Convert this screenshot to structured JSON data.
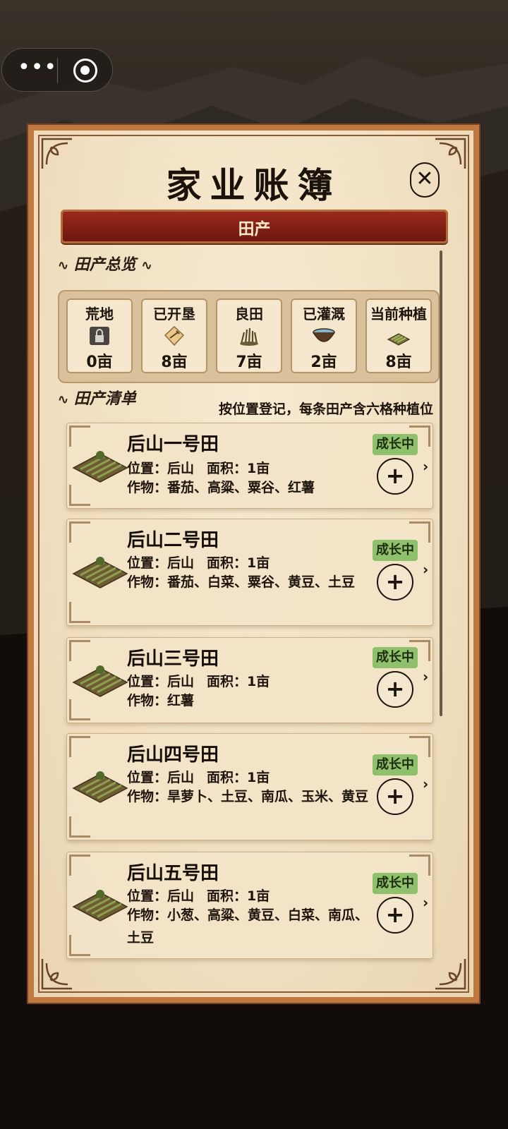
{
  "capsule": {
    "menu_icon": "more-dots-icon",
    "close_icon": "target-circle-icon"
  },
  "panel": {
    "title": "家业账簿",
    "close_symbol": "✕",
    "tab_label": "田产",
    "overview_heading": "田产总览",
    "list_heading": "田产清单",
    "list_note": "按位置登记，每条田产含六格种植位"
  },
  "stats": [
    {
      "label": "荒地",
      "value": "0亩",
      "icon": "lock-icon"
    },
    {
      "label": "已开垦",
      "value": "8亩",
      "icon": "hoe-sign-icon"
    },
    {
      "label": "良田",
      "value": "7亩",
      "icon": "grass-tuft-icon"
    },
    {
      "label": "已灌溉",
      "value": "2亩",
      "icon": "water-bowl-icon"
    },
    {
      "label": "当前种植",
      "value": "8亩",
      "icon": "crop-field-icon"
    }
  ],
  "fields": [
    {
      "name": "后山一号田",
      "location": "位置：后山",
      "area": "面积：1亩",
      "crops": "作物：番茄、高粱、粟谷、红薯",
      "status": "成长中",
      "plus": "+",
      "chevron": "›"
    },
    {
      "name": "后山二号田",
      "location": "位置：后山",
      "area": "面积：1亩",
      "crops": "作物：番茄、白菜、粟谷、黄豆、土豆",
      "status": "成长中",
      "plus": "+",
      "chevron": "›"
    },
    {
      "name": "后山三号田",
      "location": "位置：后山",
      "area": "面积：1亩",
      "crops": "作物：红薯",
      "status": "成长中",
      "plus": "+",
      "chevron": "›"
    },
    {
      "name": "后山四号田",
      "location": "位置：后山",
      "area": "面积：1亩",
      "crops": "作物：旱萝卜、土豆、南瓜、玉米、黄豆",
      "status": "成长中",
      "plus": "+",
      "chevron": "›"
    },
    {
      "name": "后山五号田",
      "location": "位置：后山",
      "area": "面积：1亩",
      "crops": "作物：小葱、高粱、黄豆、白菜、南瓜、土豆",
      "status": "成长中",
      "plus": "+",
      "chevron": "›"
    }
  ],
  "colors": {
    "panel_bg": "#f3e4c7",
    "banner_red": "#8b2417",
    "status_green": "#8fc16c",
    "frame_brown": "#c07a41"
  }
}
